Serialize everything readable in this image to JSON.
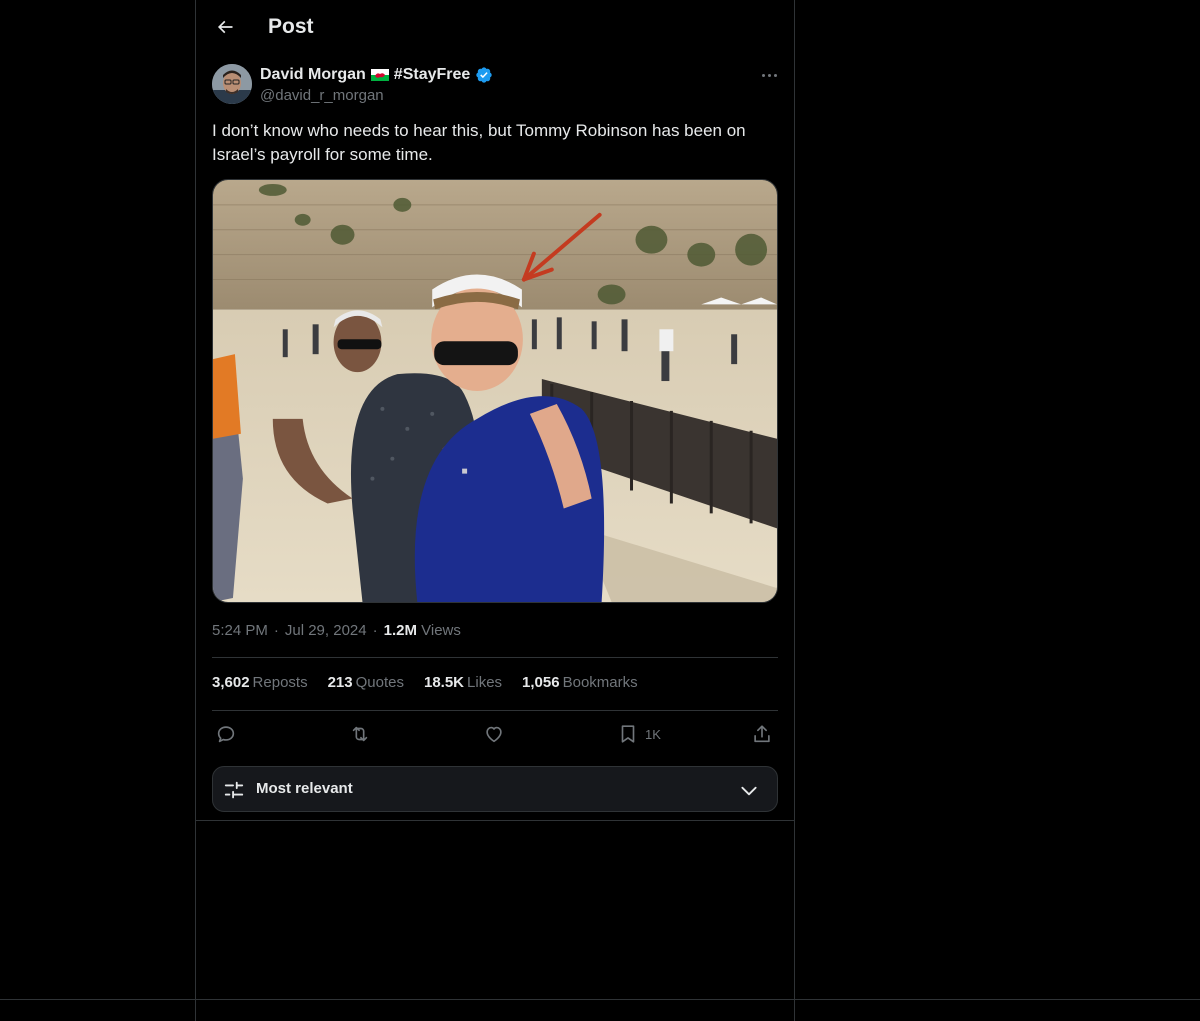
{
  "header": {
    "title": "Post",
    "back_icon": "arrow-left-icon"
  },
  "author": {
    "display_name": "David Morgan",
    "flag_icon": "wales-flag-icon",
    "hashtag": "#StayFree",
    "verified_icon": "verified-badge-icon",
    "handle": "@david_r_morgan"
  },
  "post": {
    "text": "I don’t know who needs to hear this, but Tommy Robinson has been on Israel’s payroll for some time.",
    "image_description_icon": "photo-image",
    "time": "5:24 PM",
    "date": "Jul 29, 2024",
    "views_count": "1.2M",
    "views_label": "Views"
  },
  "stats": {
    "reposts_count": "3,602",
    "reposts_label": "Reposts",
    "quotes_count": "213",
    "quotes_label": "Quotes",
    "likes_count": "18.5K",
    "likes_label": "Likes",
    "bookmarks_count": "1,056",
    "bookmarks_label": "Bookmarks"
  },
  "actions": {
    "reply_icon": "reply-icon",
    "repost_icon": "repost-icon",
    "like_icon": "heart-icon",
    "bookmark_icon": "bookmark-icon",
    "bookmark_count": "1K",
    "share_icon": "share-icon"
  },
  "replies_sort": {
    "label": "Most relevant",
    "icon": "sliders-icon",
    "chevron": "chevron-down-icon"
  },
  "colors": {
    "background": "#000000",
    "text": "#e7e9ea",
    "muted": "#71767b",
    "border": "#2f3336",
    "verified": "#1d9bf0"
  }
}
